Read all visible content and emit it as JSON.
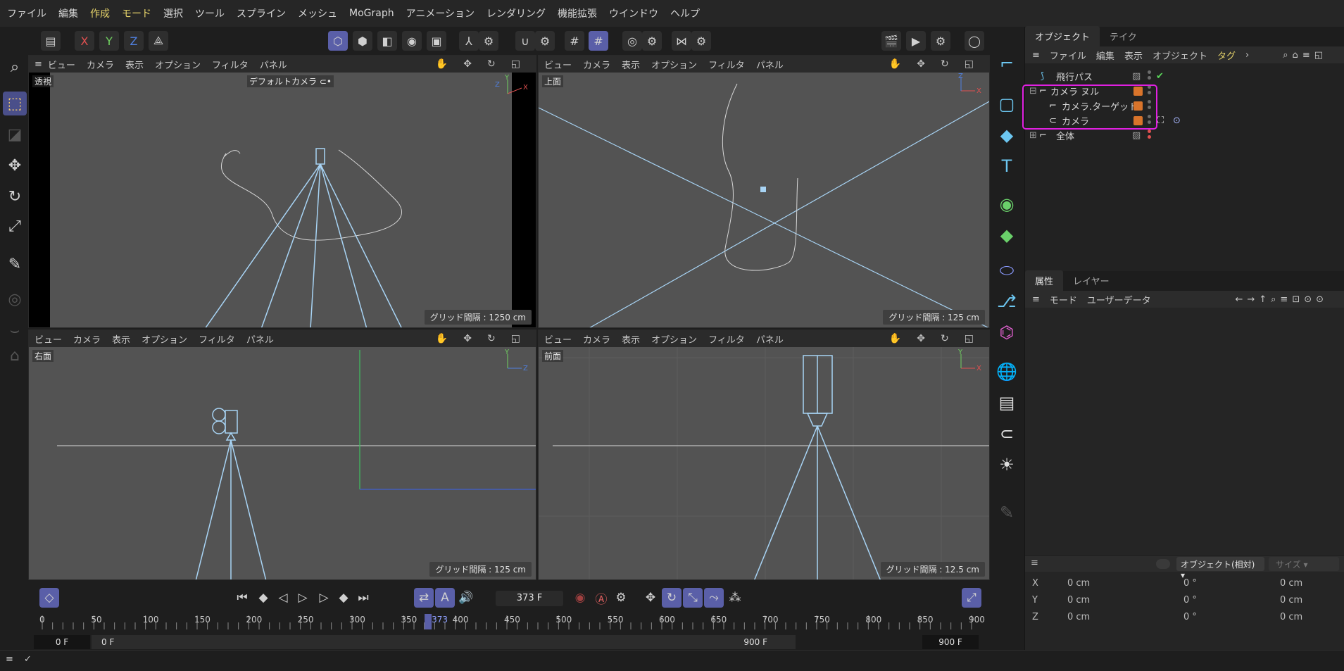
{
  "menu": [
    "ファイル",
    "編集",
    "作成",
    "モード",
    "選択",
    "ツール",
    "スプライン",
    "メッシュ",
    "MoGraph",
    "アニメーション",
    "レンダリング",
    "機能拡張",
    "ウインドウ",
    "ヘルプ"
  ],
  "axes": {
    "x": "X",
    "y": "Y",
    "z": "Z"
  },
  "viewport_menu": [
    "ビュー",
    "カメラ",
    "表示",
    "オプション",
    "フィルタ",
    "パネル"
  ],
  "viewports": {
    "perspective": {
      "label": "透視",
      "camera": "デフォルトカメラ ⊂•",
      "grid": "グリッド間隔 : 1250 cm"
    },
    "top": {
      "label": "上面",
      "grid": "グリッド間隔 : 125 cm"
    },
    "right": {
      "label": "右面",
      "grid": "グリッド間隔 : 125 cm"
    },
    "front": {
      "label": "前面",
      "grid": "グリッド間隔 : 12.5 cm"
    }
  },
  "object_panel": {
    "tabs": [
      "オブジェクト",
      "テイク"
    ],
    "menu": [
      "ファイル",
      "編集",
      "表示",
      "オブジェクト",
      "タグ"
    ],
    "objects": [
      {
        "name": "飛行パス",
        "expander": ""
      },
      {
        "name": "カメラ ヌル",
        "expander": "⊟"
      },
      {
        "name": "カメラ.ターゲット",
        "expander": ""
      },
      {
        "name": "カメラ",
        "expander": ""
      },
      {
        "name": "全体",
        "expander": "⊞"
      }
    ]
  },
  "attr_panel": {
    "tabs": [
      "属性",
      "レイヤー"
    ],
    "menu": [
      "モード",
      "ユーザーデータ"
    ]
  },
  "coords": {
    "mode": "オブジェクト(相対)",
    "size": "サイズ",
    "rows": [
      {
        "axis": "X",
        "pos": "0 cm",
        "rot": "0 °",
        "size": "0 cm"
      },
      {
        "axis": "Y",
        "pos": "0 cm",
        "rot": "0 °",
        "size": "0 cm"
      },
      {
        "axis": "Z",
        "pos": "0 cm",
        "rot": "0 °",
        "size": "0 cm"
      }
    ]
  },
  "timeline": {
    "current_frame": "373 F",
    "playhead": 373,
    "ticks": [
      "0",
      "50",
      "100",
      "150",
      "200",
      "250",
      "300",
      "350",
      "400",
      "450",
      "500",
      "550",
      "600",
      "650",
      "700",
      "750",
      "800",
      "850",
      "900"
    ],
    "start": "0 F",
    "start2": "0 F",
    "end": "900 F",
    "end2": "900 F",
    "auto_key_label": "A"
  },
  "colors": {
    "accent": "#5a5fa8",
    "highlight": "#e020e0",
    "wire": "#a8d4f5",
    "swatch": "#d9742b"
  }
}
